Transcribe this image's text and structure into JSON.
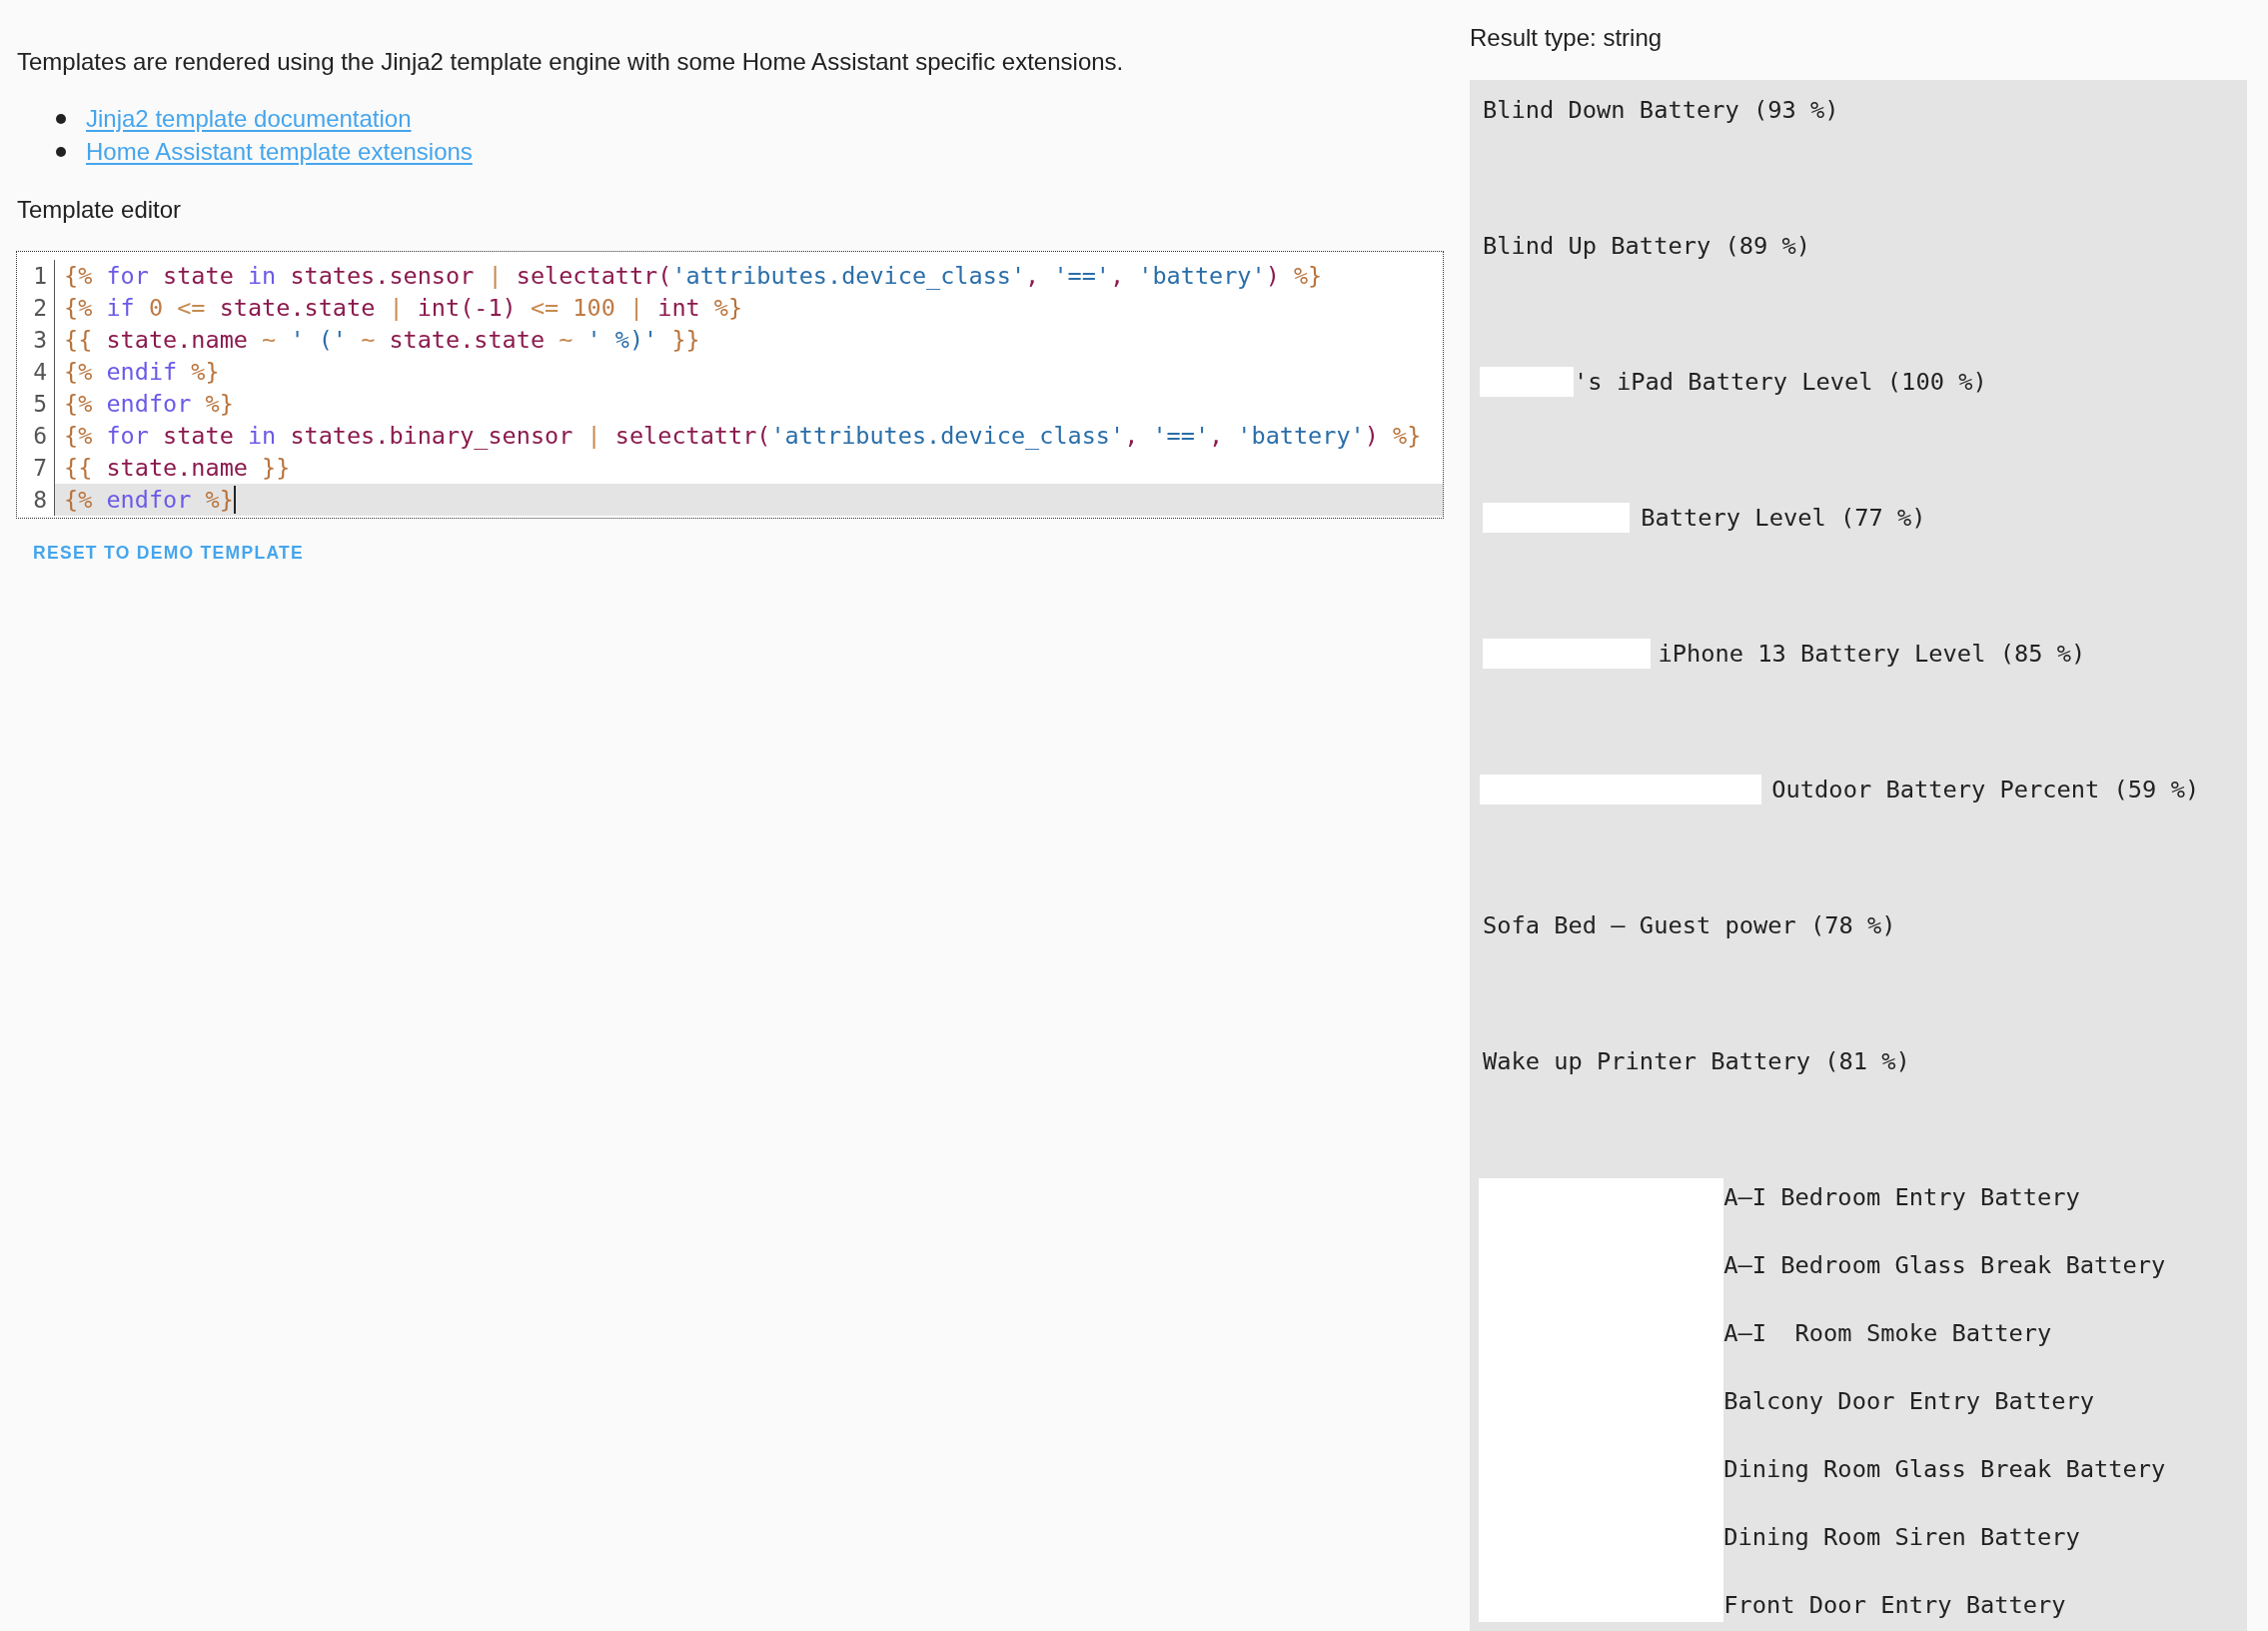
{
  "intro": {
    "text": "Templates are rendered using the Jinja2 template engine with some Home Assistant specific extensions.",
    "links": [
      "Jinja2 template documentation",
      "Home Assistant template extensions"
    ]
  },
  "editor": {
    "label": "Template editor",
    "lines": [
      {
        "number": "1",
        "active": false,
        "tokens": [
          {
            "text": "{%",
            "kind": "delimiter"
          },
          {
            "text": " for",
            "kind": "keyword"
          },
          {
            "text": " state",
            "kind": "name"
          },
          {
            "text": " in",
            "kind": "keyword"
          },
          {
            "text": " states.sensor",
            "kind": "name"
          },
          {
            "text": " |",
            "kind": "operator"
          },
          {
            "text": " selectattr(",
            "kind": "name"
          },
          {
            "text": "'attributes.device_class'",
            "kind": "string"
          },
          {
            "text": ", ",
            "kind": "name"
          },
          {
            "text": "'=='",
            "kind": "string"
          },
          {
            "text": ", ",
            "kind": "name"
          },
          {
            "text": "'battery'",
            "kind": "string"
          },
          {
            "text": ")",
            "kind": "name"
          },
          {
            "text": " %}",
            "kind": "delimiter"
          }
        ]
      },
      {
        "number": "2",
        "active": false,
        "tokens": [
          {
            "text": "{%",
            "kind": "delimiter"
          },
          {
            "text": " if",
            "kind": "keyword"
          },
          {
            "text": " 0",
            "kind": "number"
          },
          {
            "text": " <=",
            "kind": "operator"
          },
          {
            "text": " state.state",
            "kind": "name"
          },
          {
            "text": " |",
            "kind": "operator"
          },
          {
            "text": " int(-1)",
            "kind": "name"
          },
          {
            "text": " <=",
            "kind": "operator"
          },
          {
            "text": " 100",
            "kind": "number"
          },
          {
            "text": " |",
            "kind": "operator"
          },
          {
            "text": " int",
            "kind": "name"
          },
          {
            "text": " %}",
            "kind": "delimiter"
          }
        ]
      },
      {
        "number": "3",
        "active": false,
        "tokens": [
          {
            "text": "{{",
            "kind": "delimiter"
          },
          {
            "text": " state.name",
            "kind": "name"
          },
          {
            "text": " ~",
            "kind": "operator"
          },
          {
            "text": " ' ('",
            "kind": "string"
          },
          {
            "text": " ~",
            "kind": "operator"
          },
          {
            "text": " state.state",
            "kind": "name"
          },
          {
            "text": " ~",
            "kind": "operator"
          },
          {
            "text": " ' %)'",
            "kind": "string"
          },
          {
            "text": " }}",
            "kind": "delimiter"
          }
        ]
      },
      {
        "number": "4",
        "active": false,
        "tokens": [
          {
            "text": "{%",
            "kind": "delimiter"
          },
          {
            "text": " endif",
            "kind": "keyword"
          },
          {
            "text": " %}",
            "kind": "delimiter"
          }
        ]
      },
      {
        "number": "5",
        "active": false,
        "tokens": [
          {
            "text": "{%",
            "kind": "delimiter"
          },
          {
            "text": " endfor",
            "kind": "keyword"
          },
          {
            "text": " %}",
            "kind": "delimiter"
          }
        ]
      },
      {
        "number": "6",
        "active": false,
        "tokens": [
          {
            "text": "{%",
            "kind": "delimiter"
          },
          {
            "text": " for",
            "kind": "keyword"
          },
          {
            "text": " state",
            "kind": "name"
          },
          {
            "text": " in",
            "kind": "keyword"
          },
          {
            "text": " states.binary_sensor",
            "kind": "name"
          },
          {
            "text": " |",
            "kind": "operator"
          },
          {
            "text": " selectattr(",
            "kind": "name"
          },
          {
            "text": "'attributes.device_class'",
            "kind": "string"
          },
          {
            "text": ", ",
            "kind": "name"
          },
          {
            "text": "'=='",
            "kind": "string"
          },
          {
            "text": ", ",
            "kind": "name"
          },
          {
            "text": "'battery'",
            "kind": "string"
          },
          {
            "text": ")",
            "kind": "name"
          },
          {
            "text": " %}",
            "kind": "delimiter"
          }
        ]
      },
      {
        "number": "7",
        "active": false,
        "tokens": [
          {
            "text": "{{",
            "kind": "delimiter"
          },
          {
            "text": " state.name",
            "kind": "name"
          },
          {
            "text": " }}",
            "kind": "delimiter"
          }
        ]
      },
      {
        "number": "8",
        "active": true,
        "tokens": [
          {
            "text": "{%",
            "kind": "delimiter"
          },
          {
            "text": " endfor",
            "kind": "keyword"
          },
          {
            "text": " %}",
            "kind": "delimiter"
          }
        ]
      }
    ]
  },
  "reset_button": "RESET TO DEMO TEMPLATE",
  "result": {
    "type_label": "Result type: string",
    "groups": [
      {
        "kind": "spaced",
        "redacted": false,
        "lines": [
          {
            "text": "Blind Down Battery (93 %)",
            "kind": "plain"
          },
          {
            "text": "Blind Up Battery (89 %)",
            "kind": "plain"
          },
          {
            "text": "'s iPad Battery Level (100 %)",
            "kind": "short"
          },
          {
            "text": "Battery Level (77 %)",
            "kind": "medium"
          },
          {
            "text": "iPhone 13 Battery Level (85 %)",
            "kind": "long"
          },
          {
            "text": "Outdoor Battery Percent (59 %)",
            "kind": "wide"
          },
          {
            "text": "Sofa Bed – Guest power (78 %)",
            "kind": "plain"
          },
          {
            "text": "Wake up Printer Battery (81 %)",
            "kind": "plain"
          }
        ]
      },
      {
        "kind": "compact",
        "redacted": true,
        "lines": [
          {
            "text": "A–I Bedroom Entry Battery",
            "kind": "plain"
          },
          {
            "text": "A–I Bedroom Glass Break Battery",
            "kind": "plain"
          },
          {
            "text": "A–I  Room Smoke Battery",
            "kind": "plain"
          },
          {
            "text": "Balcony Door Entry Battery",
            "kind": "plain"
          },
          {
            "text": "Dining Room Glass Break Battery",
            "kind": "plain"
          },
          {
            "text": "Dining Room Siren Battery",
            "kind": "plain"
          },
          {
            "text": "Front Door Entry Battery",
            "kind": "plain"
          }
        ]
      }
    ]
  }
}
